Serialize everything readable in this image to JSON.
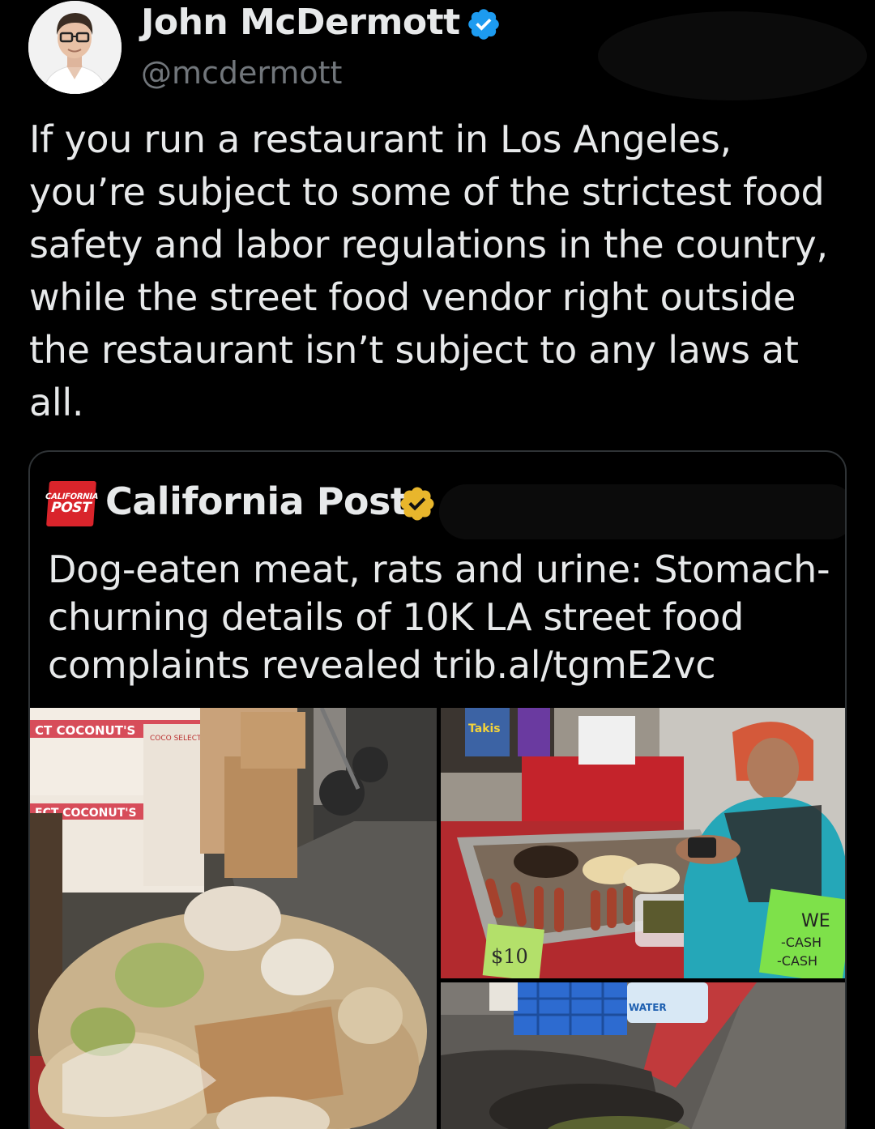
{
  "tweet": {
    "author_name": "John McDermott",
    "handle": "@mcdermott",
    "verified_icon": "verified-badge-blue",
    "verified_color": "#1d9bf0",
    "text": "If you run a restaurant in Los Angeles, you’re subject to some of the strictest food safety and labor regulations in the country, while the street food vendor right outside the restaurant isn’t subject to any laws at all."
  },
  "quoted_post": {
    "source_name": "California Post",
    "logo_text_top": "CALIFORNIA",
    "logo_text_bottom": "POST",
    "logo_color": "#d9242b",
    "verified_icon": "verified-badge-gold",
    "verified_color": "#e8b62c",
    "text": "Dog-eaten meat, rats and urine: Stomach-churning details of 10K LA street food complaints revealed trib.al/tgmE2vc",
    "photos": [
      {
        "subject": "coconut-waste-on-sidewalk",
        "box_text_1": "CT COCONUT'S",
        "box_text_2": "ECT COCONUT'S",
        "box_text_3": "COCO SELECTO"
      },
      {
        "subject": "street-vendor-grilling-hotdogs",
        "sign_text_1": "WE",
        "sign_text_2": "-CASH",
        "sign_text_3": "-CASH",
        "price_sign": "$10",
        "snack_text": "Takis"
      },
      {
        "subject": "pothole-by-red-curb",
        "bottle_text": "WATER"
      }
    ]
  }
}
